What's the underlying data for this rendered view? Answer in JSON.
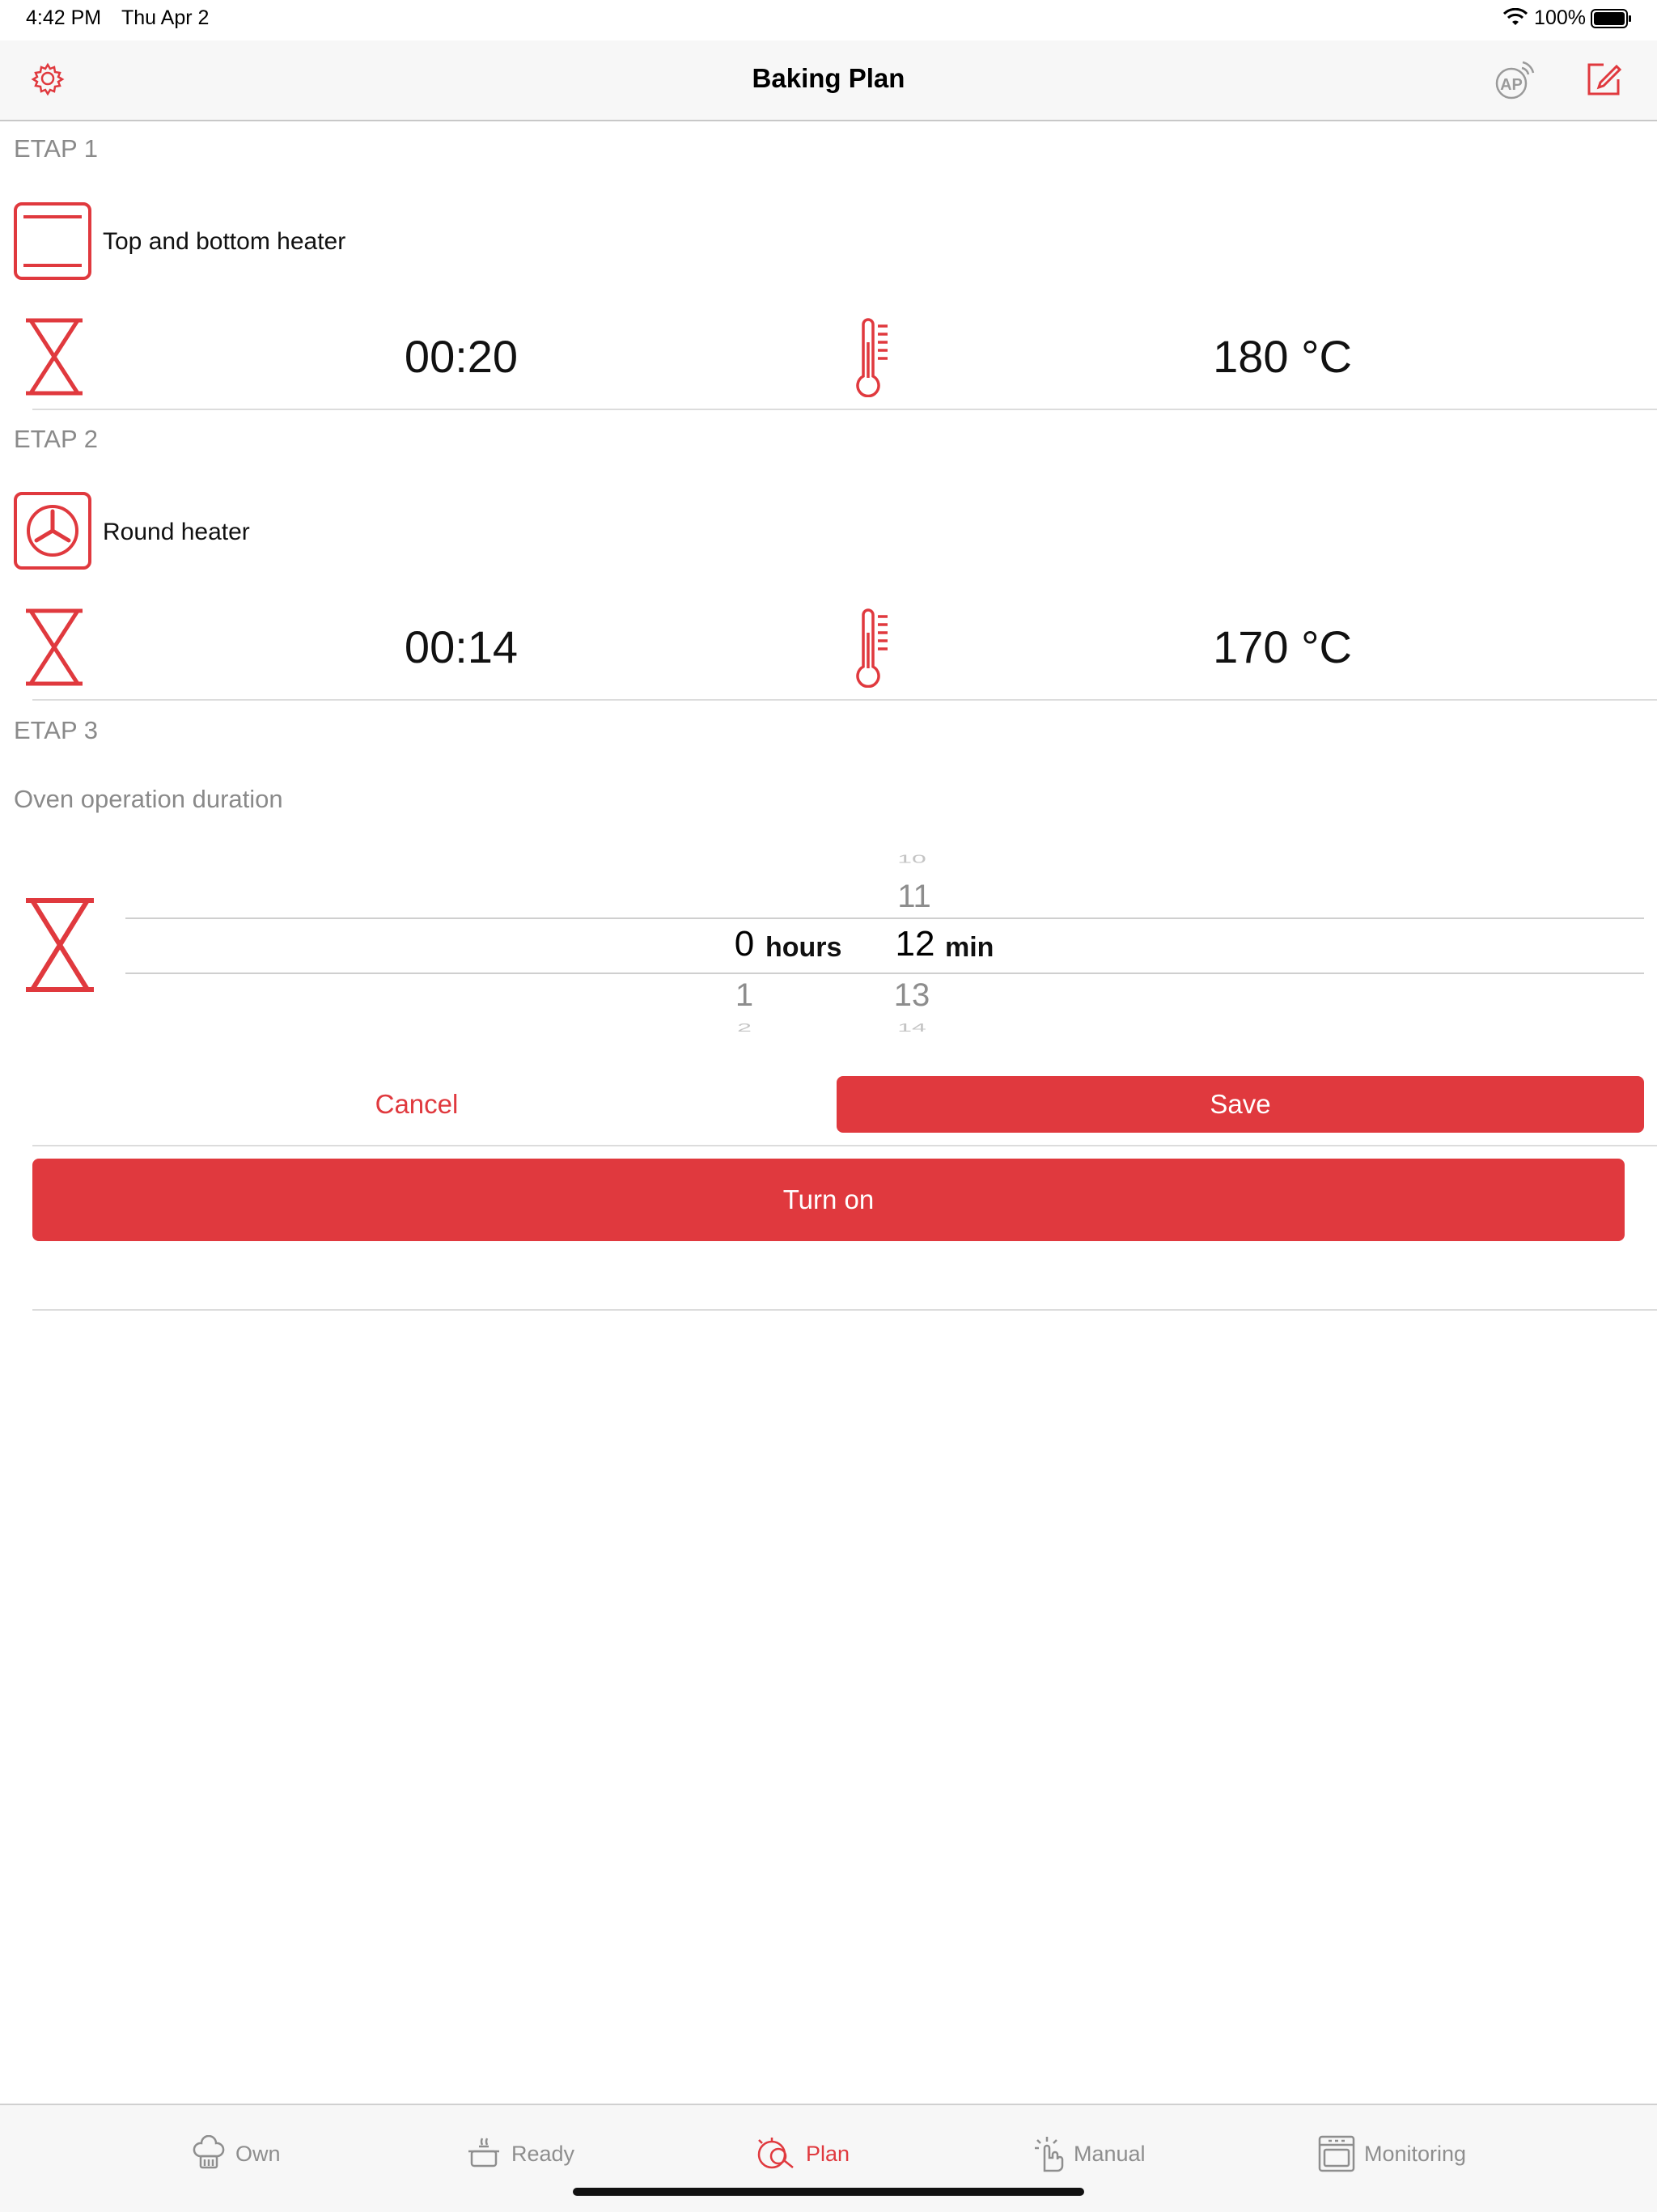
{
  "status_bar": {
    "time": "4:42 PM",
    "date": "Thu Apr 2",
    "battery": "100%"
  },
  "nav": {
    "title": "Baking Plan",
    "settings_icon": "gear-icon",
    "ap_icon": "ap-icon",
    "edit_icon": "edit-icon"
  },
  "stages": [
    {
      "label": "ETAP 1",
      "mode": "Top and bottom heater",
      "time": "00:20",
      "temp": "180 °C"
    },
    {
      "label": "ETAP 2",
      "mode": "Round heater",
      "time": "00:14",
      "temp": "170 °C"
    }
  ],
  "stage3": {
    "label": "ETAP 3",
    "duration_label": "Oven operation duration",
    "hours": {
      "selected": "0",
      "unit": "hours",
      "below": [
        "1",
        "2"
      ]
    },
    "minutes": {
      "above": [
        "10",
        "11"
      ],
      "selected": "12",
      "unit": "min",
      "below": [
        "13",
        "14"
      ]
    },
    "cancel": "Cancel",
    "save": "Save"
  },
  "turn_on": "Turn on",
  "tabs": [
    {
      "label": "Own",
      "icon": "chef-hat-icon"
    },
    {
      "label": "Ready",
      "icon": "pot-icon"
    },
    {
      "label": "Plan",
      "icon": "plan-icon",
      "active": true
    },
    {
      "label": "Manual",
      "icon": "hand-tap-icon"
    },
    {
      "label": "Monitoring",
      "icon": "oven-monitor-icon"
    }
  ],
  "colors": {
    "accent": "#e0393e",
    "muted": "#8a8a8a"
  }
}
